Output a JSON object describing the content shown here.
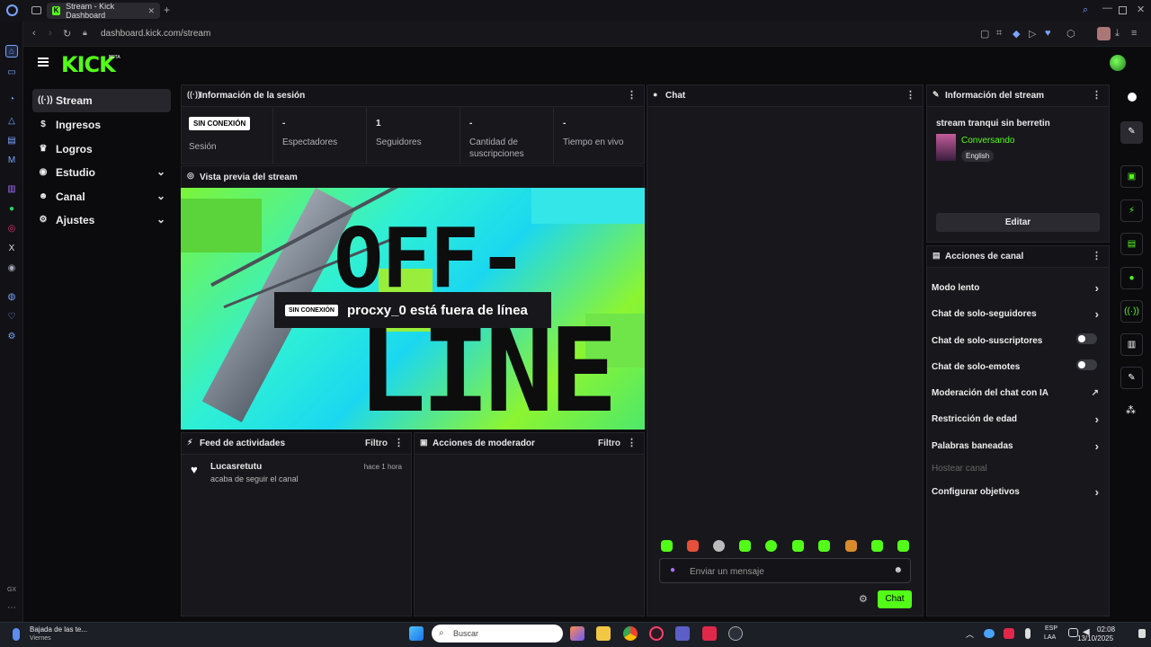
{
  "browser": {
    "tab_title": "Stream - Kick Dashboard",
    "url": "dashboard.kick.com/stream"
  },
  "brand": {
    "logo": "KICK",
    "beta": "BETA",
    "accent": "#53fc18"
  },
  "nav": {
    "items": [
      {
        "label": "Stream",
        "icon": "broadcast-icon"
      },
      {
        "label": "Ingresos",
        "icon": "money-icon"
      },
      {
        "label": "Logros",
        "icon": "trophy-icon"
      },
      {
        "label": "Estudio",
        "icon": "studio-icon"
      },
      {
        "label": "Canal",
        "icon": "users-icon"
      },
      {
        "label": "Ajustes",
        "icon": "gear-icon"
      }
    ]
  },
  "session": {
    "title": "Información de la sesión",
    "status_badge": "SIN CONEXIÓN",
    "status_label": "Sesión",
    "stats": [
      {
        "value": "-",
        "label": "Espectadores"
      },
      {
        "value": "1",
        "label": "Seguidores"
      },
      {
        "value": "-",
        "label": "Cantidad de suscripciones"
      },
      {
        "value": "-",
        "label": "Tiempo en vivo"
      }
    ]
  },
  "preview": {
    "title": "Vista previa del stream",
    "badge": "SIN CONEXIÓN",
    "message": "procxy_0 está fuera de línea",
    "art_text_top": "OFF-",
    "art_text_bottom": "LINE"
  },
  "activity": {
    "title": "Feed de actividades",
    "filter": "Filtro",
    "items": [
      {
        "user": "Lucasretutu",
        "action": "acaba de seguir el canal",
        "time": "hace 1 hora"
      }
    ]
  },
  "mod_actions": {
    "title": "Acciones de moderador",
    "filter": "Filtro"
  },
  "chat": {
    "title": "Chat",
    "placeholder": "Enviar un mensaje",
    "send": "Chat"
  },
  "stream_info": {
    "title": "Información del stream",
    "stream_title": "stream tranqui sin berretin",
    "category": "Conversando",
    "language": "English",
    "edit": "Editar"
  },
  "channel_actions": {
    "title": "Acciones de canal",
    "items": [
      {
        "label": "Modo lento",
        "control": "arrow"
      },
      {
        "label": "Chat de solo-seguidores",
        "control": "arrow"
      },
      {
        "label": "Chat de solo-suscriptores",
        "control": "toggle",
        "on": false
      },
      {
        "label": "Chat de solo-emotes",
        "control": "toggle",
        "on": false
      },
      {
        "label": "Moderación del chat con IA",
        "control": "external"
      },
      {
        "label": "Restricción de edad",
        "control": "arrow"
      },
      {
        "label": "Palabras baneadas",
        "control": "arrow"
      },
      {
        "label": "Hostear canal",
        "control": "none",
        "disabled": true
      },
      {
        "label": "Configurar objetivos",
        "control": "arrow"
      }
    ]
  },
  "taskbar": {
    "news_title": "Bajada de las te...",
    "news_sub": "Viernes",
    "search": "Buscar",
    "lang": "ESP",
    "lang2": "LAA",
    "time": "02:08",
    "date": "13/10/2025"
  },
  "opera": {
    "gx": "GX"
  }
}
